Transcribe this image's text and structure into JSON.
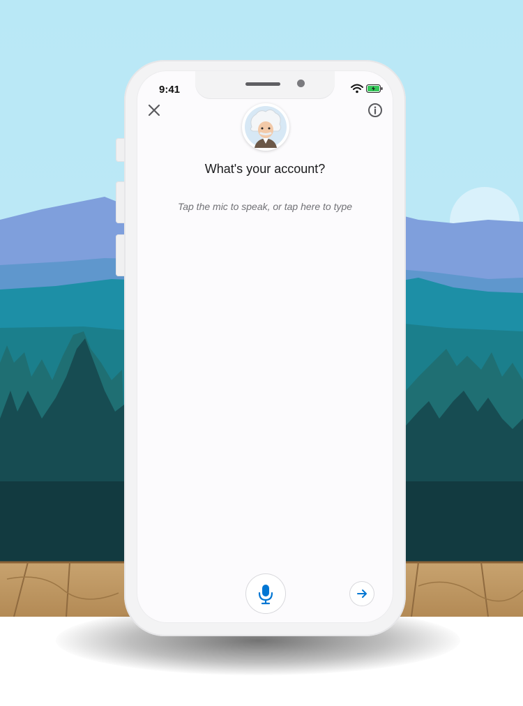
{
  "status_bar": {
    "time": "9:41"
  },
  "header": {
    "close_icon": "close-icon",
    "info_icon": "info-icon",
    "avatar": "einstein-avatar"
  },
  "prompt": {
    "question": "What's your account?",
    "input_hint": "Tap the mic to speak, or tap here to type"
  },
  "footer": {
    "mic_icon": "microphone-icon",
    "send_icon": "arrow-right-icon"
  },
  "colors": {
    "accent": "#0176d3",
    "sky": "#b8e6f5",
    "battery_fill": "#35c759"
  }
}
